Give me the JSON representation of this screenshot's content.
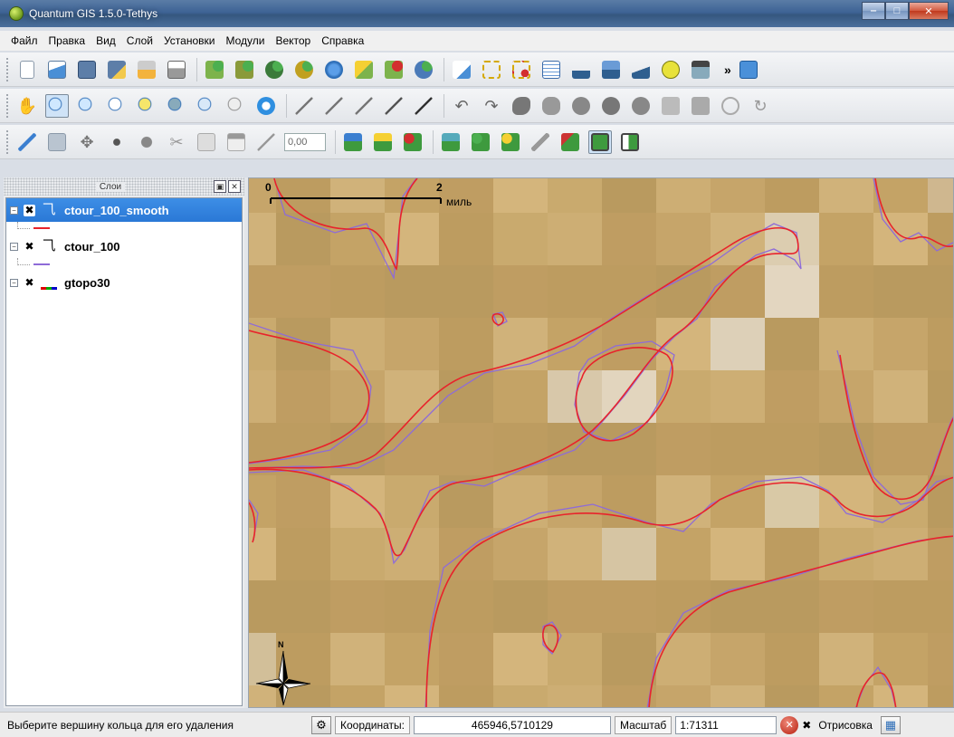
{
  "window": {
    "title": "Quantum GIS 1.5.0-Tethys"
  },
  "menu": [
    "Файл",
    "Правка",
    "Вид",
    "Слой",
    "Установки",
    "Модули",
    "Вектор",
    "Справка"
  ],
  "toolbar3": {
    "offset_value": "0,00"
  },
  "layers_panel": {
    "title": "Слои",
    "layers": [
      {
        "name": "ctour_100_smooth",
        "checked": true,
        "selected": true,
        "legend_color": "#e8232b",
        "icon": "line-layer-icon"
      },
      {
        "name": "ctour_100",
        "checked": true,
        "selected": false,
        "legend_color": "#8e6bd8",
        "icon": "line-layer-icon"
      },
      {
        "name": "gtopo30",
        "checked": true,
        "selected": false,
        "legend_color": "multicolor",
        "icon": "raster-layer-icon"
      }
    ]
  },
  "map": {
    "scalebar": {
      "start": "0",
      "end": "2",
      "unit": "миль"
    },
    "north_arrow": "N",
    "contour_colors": {
      "smooth": "#e8232b",
      "raw": "#8e6bd8"
    }
  },
  "status": {
    "message": "Выберите вершину кольца для его удаления",
    "coord_label": "Координаты:",
    "coordinates": "465946,5710129",
    "scale_label": "Масштаб",
    "scale": "1:71311",
    "render_label": "Отрисовка"
  }
}
